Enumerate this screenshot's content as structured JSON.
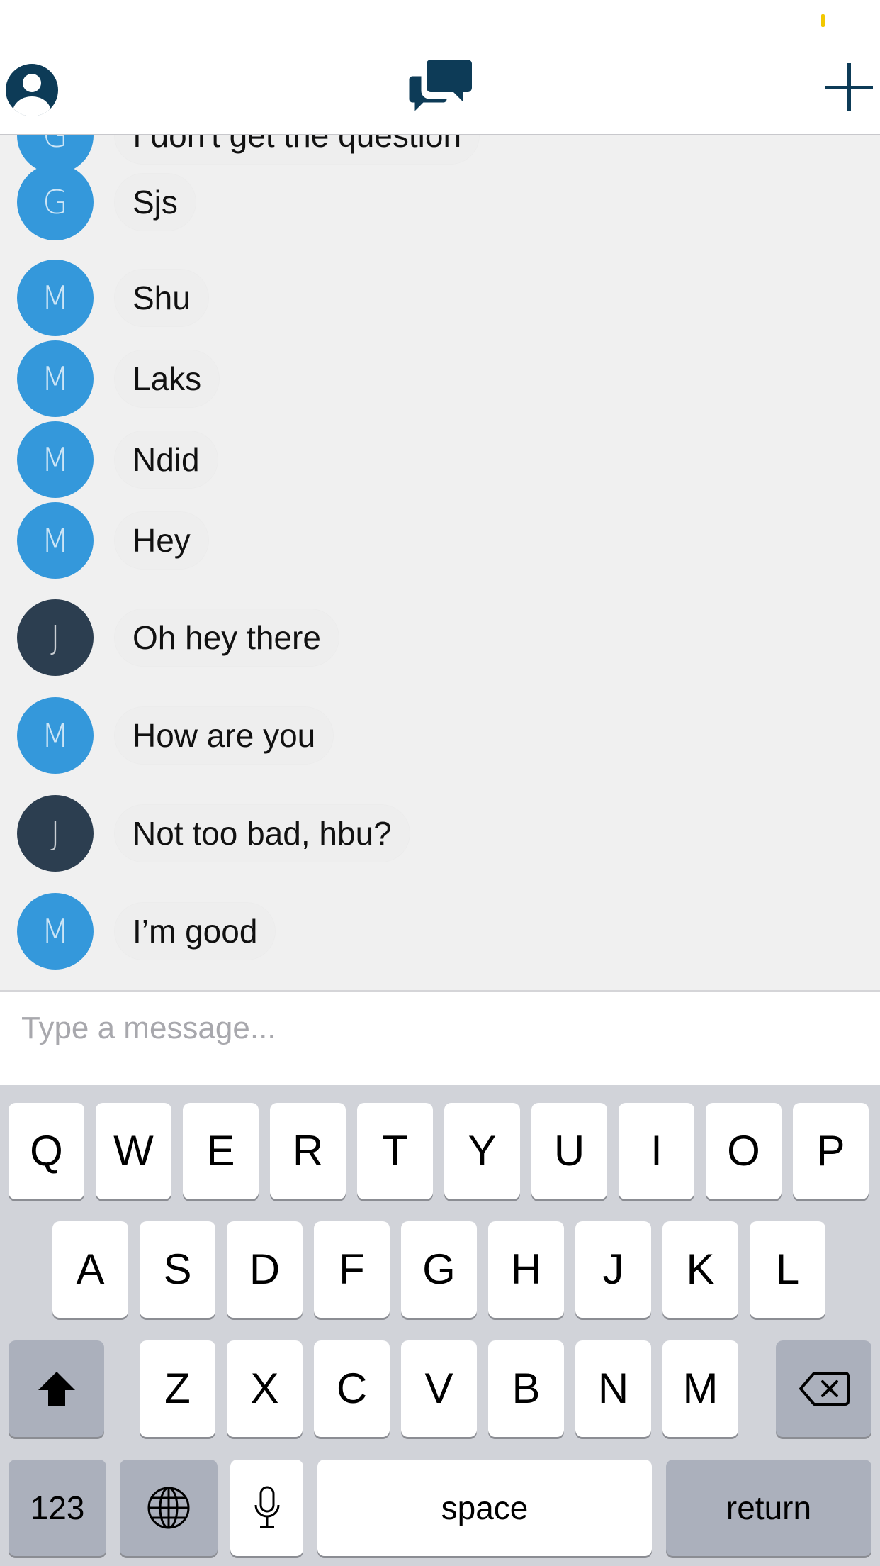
{
  "header": {
    "profile_icon": "profile-icon",
    "chat_icon": "chat-bubbles-icon",
    "add_icon": "plus-icon",
    "accent_color": "#0d3b57"
  },
  "messages": [
    {
      "initial": "G",
      "text": "I don't get the question",
      "style": "light"
    },
    {
      "initial": "G",
      "text": "Sjs",
      "style": "light"
    },
    {
      "initial": "M",
      "text": "Shu",
      "style": "light"
    },
    {
      "initial": "M",
      "text": "Laks",
      "style": "light"
    },
    {
      "initial": "M",
      "text": "Ndid",
      "style": "light"
    },
    {
      "initial": "M",
      "text": "Hey",
      "style": "light"
    },
    {
      "initial": "J",
      "text": "Oh hey there",
      "style": "dark"
    },
    {
      "initial": "M",
      "text": "How are you",
      "style": "light"
    },
    {
      "initial": "J",
      "text": "Not too bad, hbu?",
      "style": "dark"
    },
    {
      "initial": "M",
      "text": "I’m good",
      "style": "light"
    }
  ],
  "composer": {
    "placeholder": "Type a message..."
  },
  "keyboard": {
    "row1": [
      "Q",
      "W",
      "E",
      "R",
      "T",
      "Y",
      "U",
      "I",
      "O",
      "P"
    ],
    "row2": [
      "A",
      "S",
      "D",
      "F",
      "G",
      "H",
      "J",
      "K",
      "L"
    ],
    "row3": [
      "Z",
      "X",
      "C",
      "V",
      "B",
      "N",
      "M"
    ],
    "numbers_label": "123",
    "space_label": "space",
    "return_label": "return",
    "shift_icon": "shift-icon",
    "delete_icon": "backspace-icon",
    "globe_icon": "globe-icon",
    "mic_icon": "microphone-icon"
  },
  "colors": {
    "avatar_light": "#3498db",
    "avatar_dark": "#2c3e50",
    "chat_background": "#f0f0f0",
    "keyboard_background": "#d1d3d9"
  }
}
